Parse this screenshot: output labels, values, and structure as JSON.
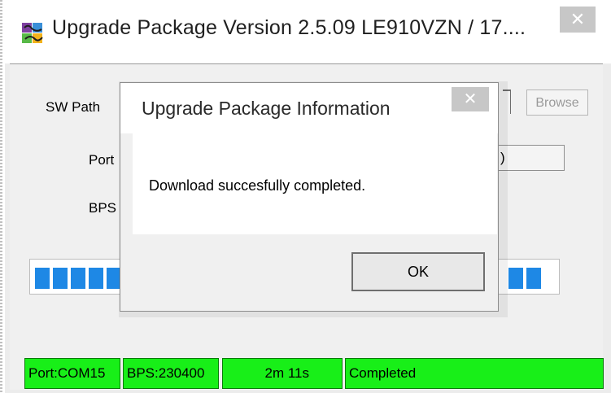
{
  "window": {
    "title": "Upgrade Package Version 2.5.09  LE910VZN / 17....",
    "close_glyph": "✕",
    "icon": "puzzle-icon"
  },
  "form": {
    "sw_path_label": "SW Path",
    "port_label": "Port",
    "bps_label": "BPS",
    "browse_label": "Browse",
    "port_button_partial": ")"
  },
  "progress": {
    "fraction": 1.0,
    "color": "#1e88e5"
  },
  "status_bar": {
    "port": "Port:COM15",
    "bps": "BPS:230400",
    "elapsed": "2m 11s",
    "status": "Completed",
    "color": "#18ef18"
  },
  "dialog": {
    "title": "Upgrade Package Information",
    "close_glyph": "✕",
    "message": "Download succesfully completed.",
    "ok_label": "OK"
  }
}
